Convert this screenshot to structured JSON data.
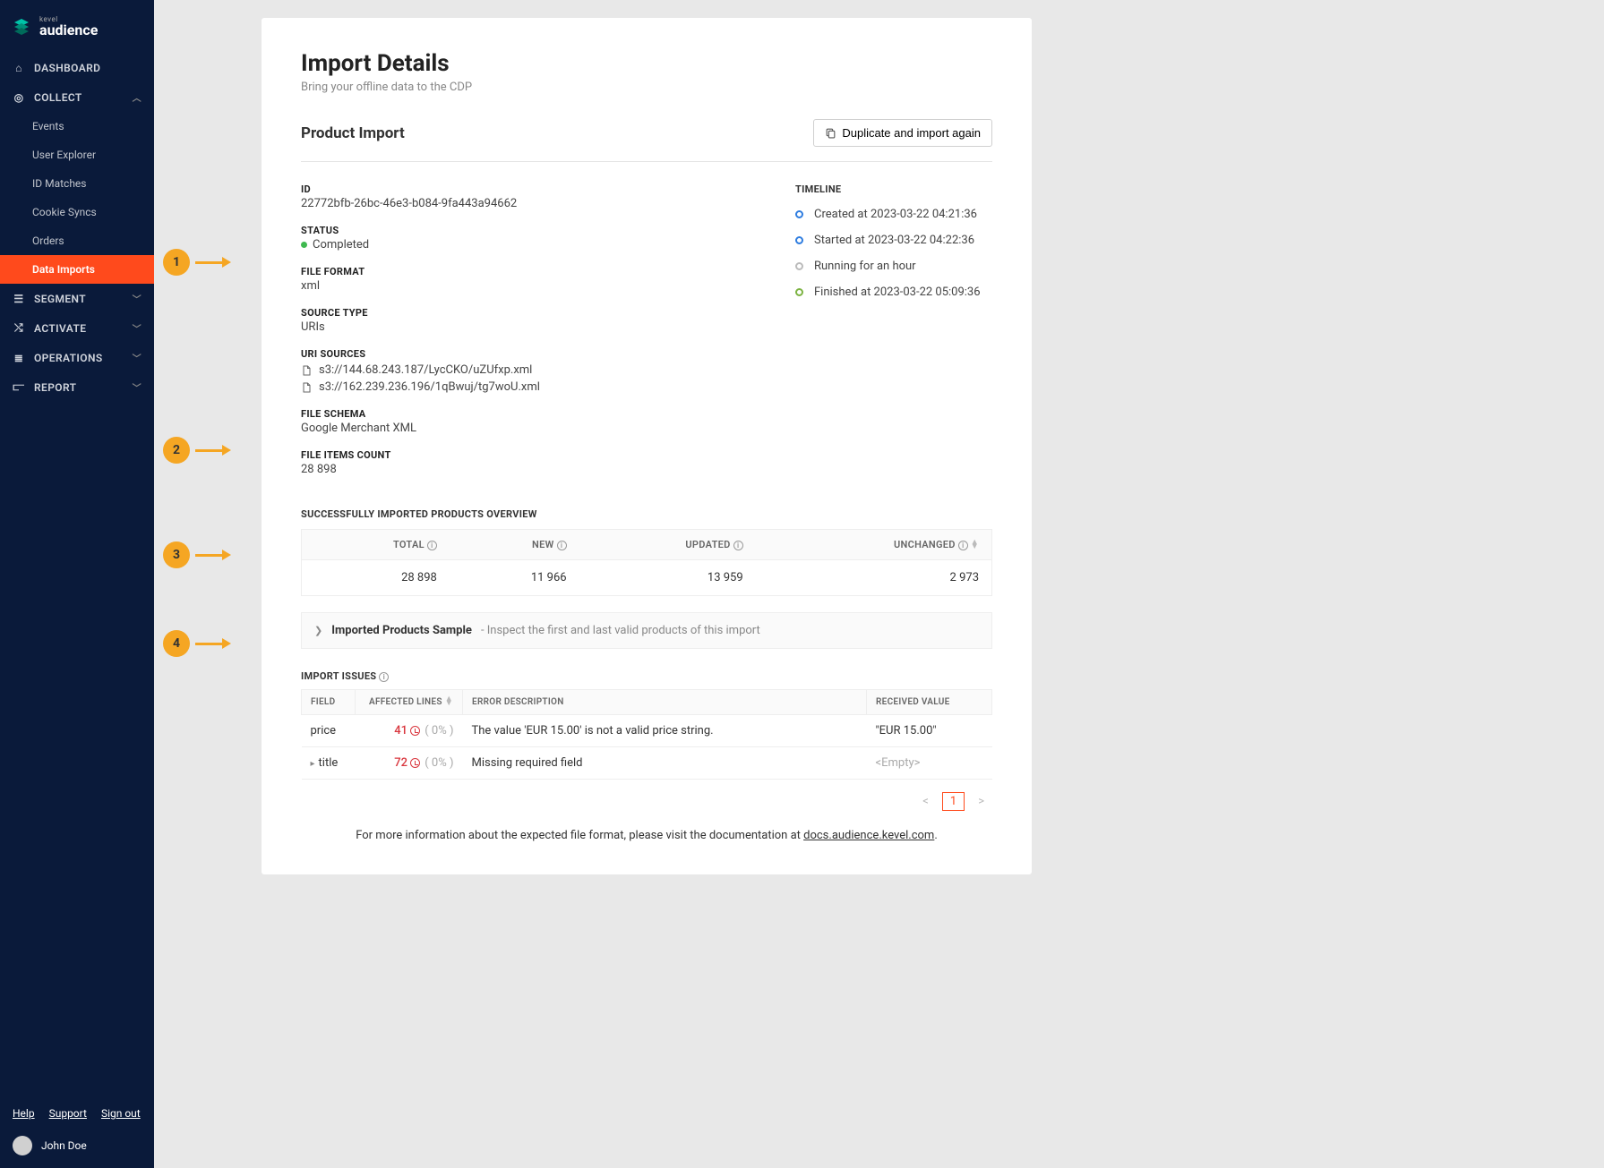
{
  "brand": {
    "kevel": "kevel",
    "audience": "audience"
  },
  "sidebar": {
    "items": [
      {
        "label": "DASHBOARD"
      },
      {
        "label": "COLLECT"
      },
      {
        "label": "SEGMENT"
      },
      {
        "label": "ACTIVATE"
      },
      {
        "label": "OPERATIONS"
      },
      {
        "label": "REPORT"
      }
    ],
    "collect_subs": [
      {
        "label": "Events"
      },
      {
        "label": "User Explorer"
      },
      {
        "label": "ID Matches"
      },
      {
        "label": "Cookie Syncs"
      },
      {
        "label": "Orders"
      },
      {
        "label": "Data Imports"
      }
    ],
    "footer": {
      "help": "Help",
      "support": "Support",
      "signout": "Sign out"
    },
    "user": "John Doe"
  },
  "page": {
    "title": "Import Details",
    "subtitle": "Bring your offline data to the CDP",
    "section": "Product Import",
    "duplicate_btn": "Duplicate and import again"
  },
  "details": {
    "id": {
      "label": "ID",
      "value": "22772bfb-26bc-46e3-b084-9fa443a94662"
    },
    "status": {
      "label": "STATUS",
      "value": "Completed"
    },
    "file_format": {
      "label": "FILE FORMAT",
      "value": "xml"
    },
    "source_type": {
      "label": "SOURCE TYPE",
      "value": "URIs"
    },
    "uri_sources": {
      "label": "URI SOURCES",
      "items": [
        "s3://144.68.243.187/LycCKO/uZUfxp.xml",
        "s3://162.239.236.196/1qBwuj/tg7woU.xml"
      ]
    },
    "file_schema": {
      "label": "FILE SCHEMA",
      "value": "Google Merchant XML"
    },
    "file_items_count": {
      "label": "FILE ITEMS COUNT",
      "value": "28 898"
    }
  },
  "timeline": {
    "label": "TIMELINE",
    "items": [
      {
        "text": "Created at 2023-03-22 04:21:36",
        "color": "blue"
      },
      {
        "text": "Started at 2023-03-22 04:22:36",
        "color": "blue"
      },
      {
        "text": "Running for an hour",
        "color": "gray"
      },
      {
        "text": "Finished at 2023-03-22 05:09:36",
        "color": "green"
      }
    ]
  },
  "overview": {
    "label": "SUCCESSFULLY IMPORTED PRODUCTS OVERVIEW",
    "headers": {
      "total": "TOTAL",
      "new": "NEW",
      "updated": "UPDATED",
      "unchanged": "UNCHANGED"
    },
    "values": {
      "total": "28 898",
      "new": "11 966",
      "updated": "13 959",
      "unchanged": "2 973"
    }
  },
  "expander": {
    "title": "Imported Products Sample",
    "sub": " - Inspect the first and last valid products of this import"
  },
  "issues": {
    "label": "IMPORT ISSUES",
    "headers": {
      "field": "FIELD",
      "affected": "AFFECTED LINES",
      "error": "ERROR DESCRIPTION",
      "received": "RECEIVED VALUE"
    },
    "rows": [
      {
        "field": "price",
        "affected": "41",
        "pct": "( 0% )",
        "error": "The value 'EUR 15.00' is not a valid price string.",
        "received": "\"EUR 15.00\"",
        "expandable": false
      },
      {
        "field": "title",
        "affected": "72",
        "pct": "( 0% )",
        "error": "Missing required field",
        "received": "<Empty>",
        "expandable": true,
        "empty": true
      }
    ]
  },
  "pagination": {
    "page": "1"
  },
  "doc_link": {
    "pre": "For more information about the expected file format, please visit the documentation at ",
    "link": "docs.audience.kevel.com",
    "post": "."
  },
  "annotations": [
    "1",
    "2",
    "3",
    "4"
  ]
}
